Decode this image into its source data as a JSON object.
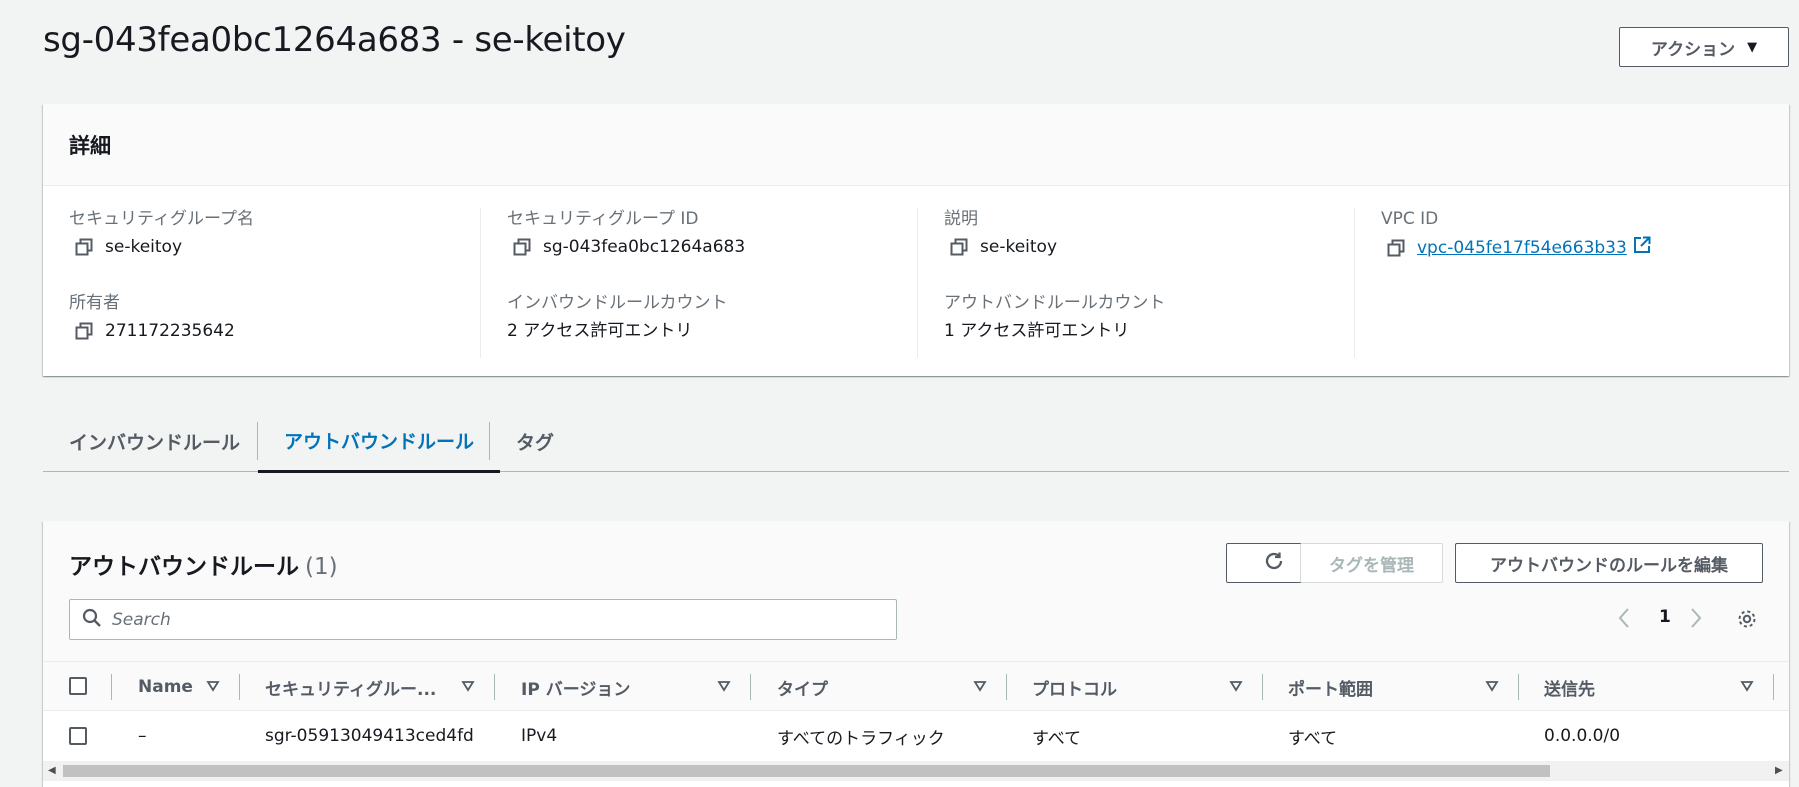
{
  "header": {
    "title": "sg-043fea0bc1264a683 - se-keitoy",
    "actions_label": "アクション"
  },
  "details": {
    "heading": "詳細",
    "sg_name_label": "セキュリティグループ名",
    "sg_name_value": "se-keitoy",
    "sg_id_label": "セキュリティグループ ID",
    "sg_id_value": "sg-043fea0bc1264a683",
    "description_label": "説明",
    "description_value": "se-keitoy",
    "vpc_label": "VPC ID",
    "vpc_value": "vpc-045fe17f54e663b33",
    "owner_label": "所有者",
    "owner_value": "271172235642",
    "inbound_count_label": "インバウンドルールカウント",
    "inbound_count_value": "2 アクセス許可エントリ",
    "outbound_count_label": "アウトバンドルールカウント",
    "outbound_count_value": "1 アクセス許可エントリ"
  },
  "tabs": [
    {
      "label": "インバウンドルール"
    },
    {
      "label": "アウトバウンドルール"
    },
    {
      "label": "タグ"
    }
  ],
  "rules": {
    "title": "アウトバウンドルール",
    "count": "(1)",
    "manage_tags_label": "タグを管理",
    "edit_label": "アウトバウンドのルールを編集",
    "search_placeholder": "Search",
    "page": "1",
    "columns": [
      "Name",
      "セキュリティグルー...",
      "IP バージョン",
      "タイプ",
      "プロトコル",
      "ポート範囲",
      "送信先"
    ],
    "rows": [
      {
        "name": "–",
        "sg_rule_id": "sgr-05913049413ced4fd",
        "ip_version": "IPv4",
        "type": "すべてのトラフィック",
        "protocol": "すべて",
        "port_range": "すべて",
        "destination": "0.0.0.0/0"
      }
    ]
  }
}
